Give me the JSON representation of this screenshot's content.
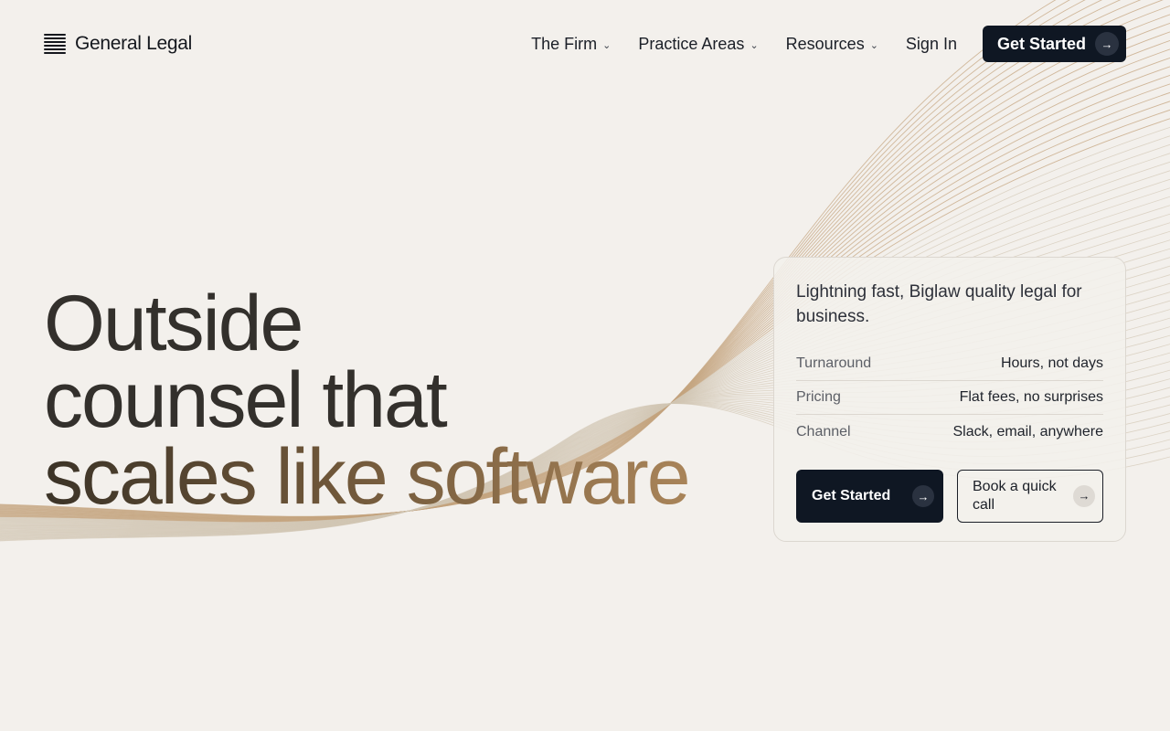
{
  "brand": {
    "name": "General Legal",
    "logo_icon": "stacked-lines-icon"
  },
  "nav": {
    "items": [
      {
        "label": "The Firm",
        "icon": "chevron-down-icon"
      },
      {
        "label": "Practice Areas",
        "icon": "chevron-down-icon"
      },
      {
        "label": "Resources",
        "icon": "chevron-down-icon"
      }
    ],
    "sign_in": "Sign In",
    "cta": "Get Started",
    "cta_icon": "arrow-right-icon"
  },
  "hero": {
    "line1": "Outside",
    "line2": "counsel that",
    "line3": "scales like software"
  },
  "card": {
    "intro": "Lightning fast, Biglaw quality legal for business.",
    "specs": [
      {
        "label": "Turnaround",
        "value": "Hours, not days"
      },
      {
        "label": "Pricing",
        "value": "Flat fees, no surprises"
      },
      {
        "label": "Channel",
        "value": "Slack, email, anywhere"
      }
    ],
    "primary_button": "Get Started",
    "secondary_button": "Book a quick call"
  },
  "colors": {
    "background": "#f3f0ec",
    "dark": "#0f1723",
    "accent_gold": "#a98459"
  }
}
